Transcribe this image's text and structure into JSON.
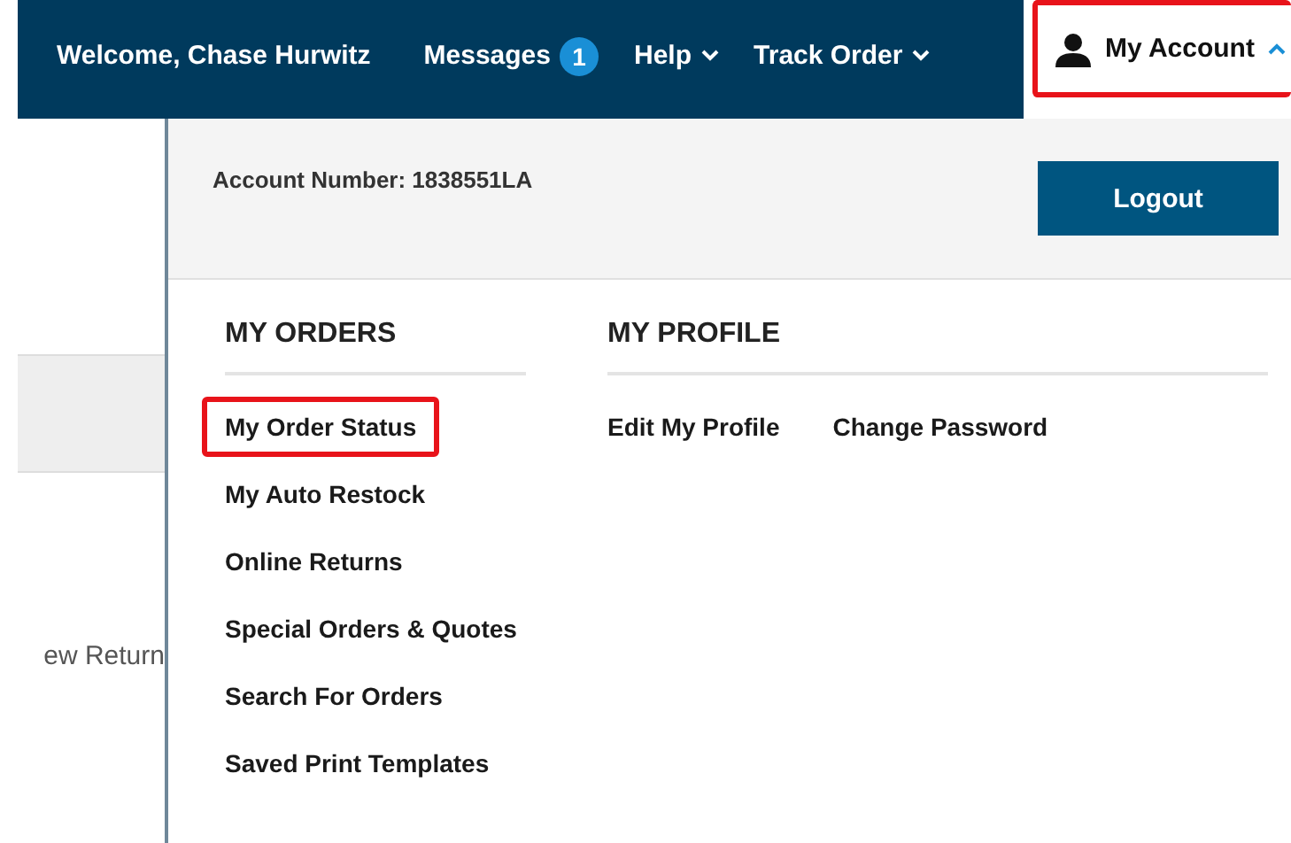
{
  "top_bar": {
    "welcome": "Welcome, Chase Hurwitz",
    "nav": [
      {
        "label": "Messages",
        "kind": "badge",
        "badge": "1"
      },
      {
        "label": "Help",
        "kind": "dropdown"
      },
      {
        "label": "Track Order",
        "kind": "dropdown"
      }
    ],
    "account": {
      "label": "My Account",
      "expanded": true,
      "highlighted": true
    }
  },
  "background": {
    "text": "ew Return"
  },
  "account_menu": {
    "account_number": "Account Number: 1838551LA",
    "logout_button": "Logout",
    "sections": [
      {
        "title": "MY ORDERS",
        "kind": "column",
        "items": [
          {
            "label": "My Order Status",
            "highlighted": true
          },
          {
            "label": "My Auto Restock",
            "highlighted": false
          },
          {
            "label": "Online Returns",
            "highlighted": false
          },
          {
            "label": "Special Orders & Quotes",
            "highlighted": false
          },
          {
            "label": "Search For Orders",
            "highlighted": false
          },
          {
            "label": "Saved Print Templates",
            "highlighted": false
          }
        ]
      },
      {
        "title": "MY PROFILE",
        "kind": "row",
        "items": [
          {
            "label": "Edit My Profile",
            "highlighted": false
          },
          {
            "label": "Change Password",
            "highlighted": false
          }
        ]
      }
    ]
  }
}
